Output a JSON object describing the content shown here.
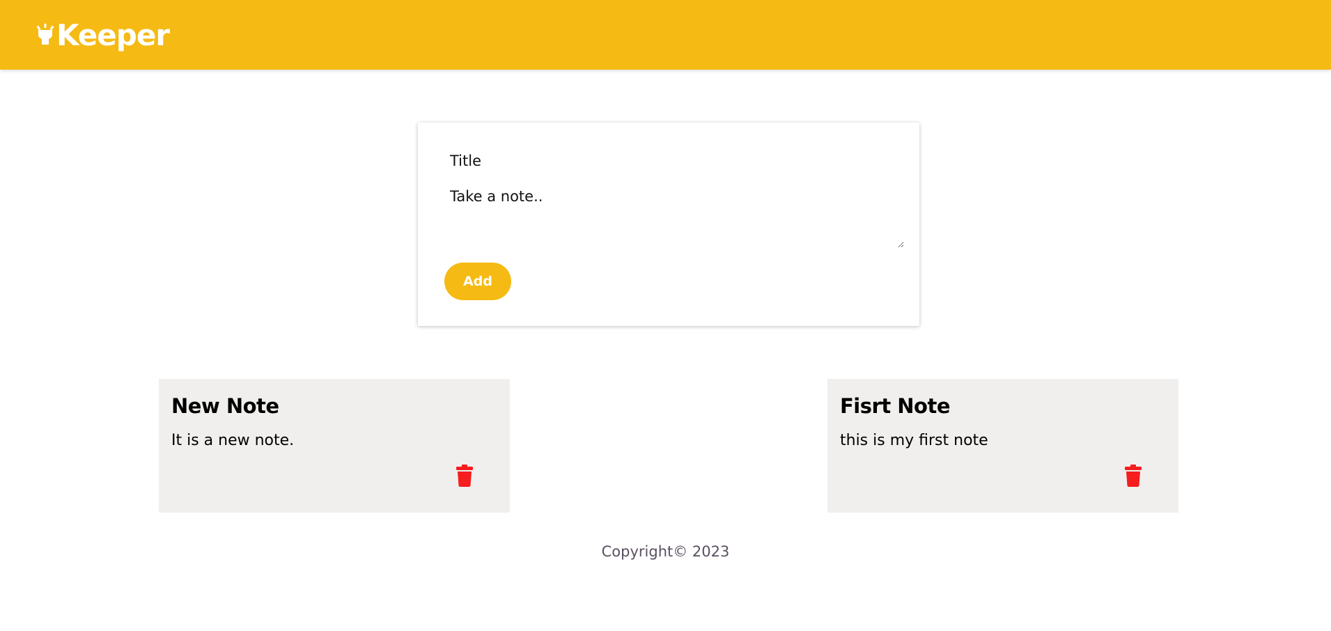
{
  "header": {
    "brand_icon": "lightbulb-icon",
    "title": "Keeper"
  },
  "create_area": {
    "title_placeholder": "Title",
    "content_placeholder": "Take a note..",
    "add_label": "Add"
  },
  "notes": [
    {
      "title": "New Note",
      "content": "It is a new note.",
      "delete_icon": "trash-icon"
    },
    {
      "title": "Fisrt Note",
      "content": "this is my first note",
      "delete_icon": "trash-icon"
    }
  ],
  "footer": {
    "copyright": "Copyright© 2023"
  },
  "colors": {
    "brand": "#f5ba13",
    "note_background": "#f0efee",
    "delete": "#f51d1d"
  }
}
